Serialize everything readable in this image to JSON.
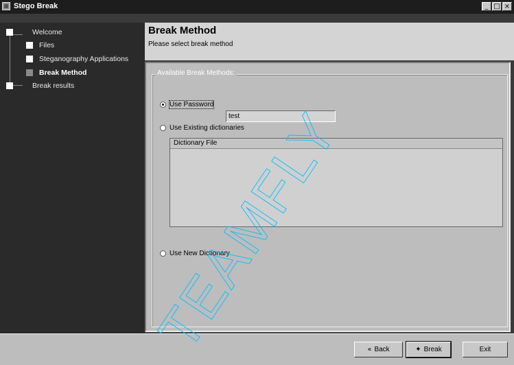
{
  "window": {
    "title": "Stego Break",
    "controls": [
      "_",
      "□",
      "×"
    ]
  },
  "sidebar": {
    "items": [
      {
        "label": "Welcome"
      },
      {
        "label": "Files"
      },
      {
        "label": "Steganography Applications"
      },
      {
        "label": "Break Method",
        "active": true
      },
      {
        "label": "Break results"
      }
    ]
  },
  "header": {
    "title": "Break Method",
    "subtitle": "Please select break method"
  },
  "main": {
    "group_label": "Available Break Methods:",
    "options": {
      "password": {
        "label": "Use Password",
        "checked": true,
        "value": "test"
      },
      "existing": {
        "label": "Use Existing dictionaries",
        "checked": false
      },
      "new_dict": {
        "label": "Use New Dictionary",
        "checked": false
      }
    },
    "dict_table": {
      "column": "Dictionary File",
      "rows": []
    }
  },
  "buttons": {
    "back": "Back",
    "break": "Break",
    "exit": "Exit"
  },
  "watermark": {
    "text": "TEAMFLY"
  },
  "colors": {
    "title_bar": "#1d1d1d",
    "sidebar": "#2a2a2a",
    "panel": "#bdbdbd",
    "header": "#d4d4d4"
  }
}
